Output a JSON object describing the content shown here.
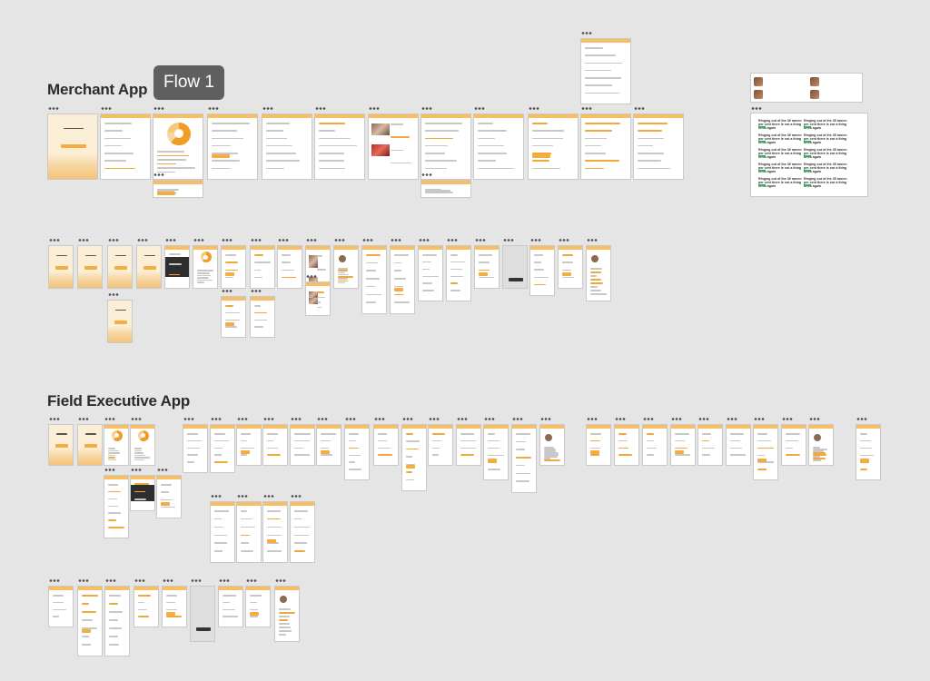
{
  "canvas": {
    "background": "#e5e5e5",
    "accent": "#f7be63",
    "accent_strong": "#f29b26"
  },
  "sections": {
    "merchant": {
      "title": "Merchant App"
    },
    "field": {
      "title": "Field Executive App"
    }
  },
  "flow_tag": {
    "label": "Flow 1"
  },
  "icons": {
    "frame_menu": "more-horizontal-icon"
  },
  "notification_card": {
    "text": "Ringing out of the 35 ramen per cent there is not a thing to do again",
    "text_alt": "Ringing out of the 35 ramen per cent there is not a thing to do again"
  }
}
